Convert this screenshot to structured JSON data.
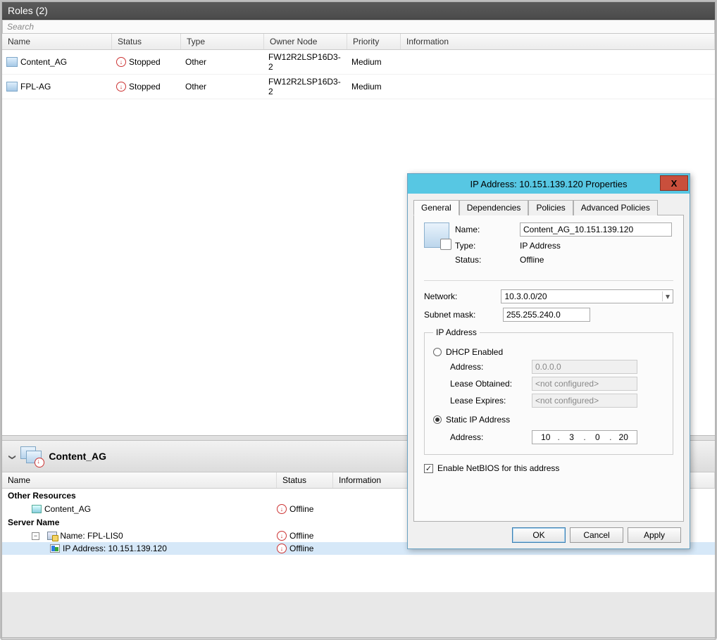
{
  "header": {
    "title": "Roles (2)",
    "search_placeholder": "Search"
  },
  "columns": {
    "name": "Name",
    "status": "Status",
    "type": "Type",
    "owner": "Owner Node",
    "priority": "Priority",
    "info": "Information"
  },
  "roles": [
    {
      "name": "Content_AG",
      "status": "Stopped",
      "type": "Other",
      "owner": "FW12R2LSP16D3-2",
      "priority": "Medium",
      "info": ""
    },
    {
      "name": "FPL-AG",
      "status": "Stopped",
      "type": "Other",
      "owner": "FW12R2LSP16D3-2",
      "priority": "Medium",
      "info": ""
    }
  ],
  "detail": {
    "title": "Content_AG",
    "columns": {
      "name": "Name",
      "status": "Status",
      "info": "Information"
    },
    "groups": {
      "other_resources": "Other Resources",
      "server_name": "Server Name"
    },
    "other_resources": [
      {
        "name": "Content_AG",
        "status": "Offline"
      }
    ],
    "server_name_item": {
      "label": "Name: FPL-LIS0",
      "status": "Offline"
    },
    "ip_item": {
      "label": "IP Address: 10.151.139.120",
      "status": "Offline"
    }
  },
  "dialog": {
    "title": "IP Address: 10.151.139.120 Properties",
    "tabs": {
      "general": "General",
      "dependencies": "Dependencies",
      "policies": "Policies",
      "adv": "Advanced Policies"
    },
    "labels": {
      "name": "Name:",
      "type": "Type:",
      "status": "Status:",
      "network": "Network:",
      "subnet": "Subnet mask:",
      "ip_group": "IP Address",
      "dhcp": "DHCP Enabled",
      "address": "Address:",
      "lease_obtained": "Lease Obtained:",
      "lease_expires": "Lease Expires:",
      "static": "Static IP Address",
      "netbios": "Enable NetBIOS for this address",
      "not_configured": "<not configured>"
    },
    "values": {
      "name": "Content_AG_10.151.139.120",
      "type": "IP Address",
      "status": "Offline",
      "network": "10.3.0.0/20",
      "subnet": "255.255.240.0",
      "dhcp_address": "0.0.0.0",
      "static_ip": {
        "a": "10",
        "b": "3",
        "c": "0",
        "d": "20"
      }
    },
    "buttons": {
      "ok": "OK",
      "cancel": "Cancel",
      "apply": "Apply"
    }
  }
}
